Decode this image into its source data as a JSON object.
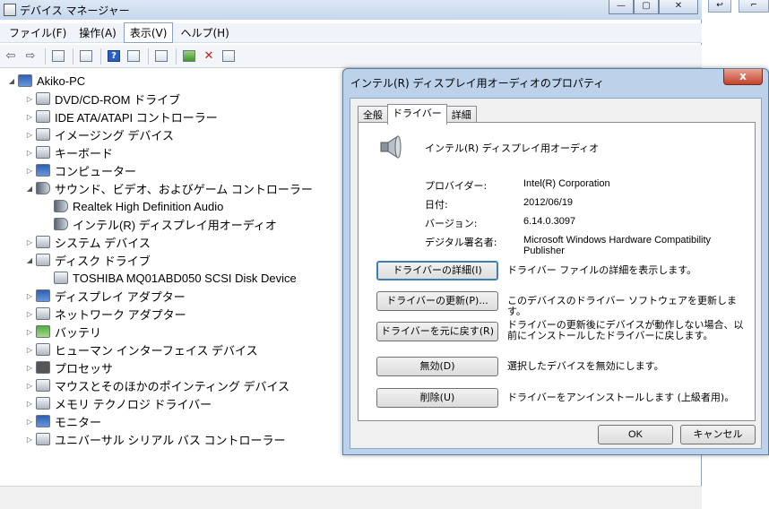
{
  "device_manager": {
    "title": "デバイス マネージャー",
    "menu": [
      "ファイル(F)",
      "操作(A)",
      "表示(V)",
      "ヘルプ(H)"
    ],
    "active_menu_index": 2,
    "toolbar_icons": [
      "back-icon",
      "forward-icon",
      "show-hide-tree-icon",
      "properties-icon",
      "help-icon",
      "action-icon",
      "scan-hardware-icon",
      "update-driver-icon",
      "uninstall-icon",
      "disable-icon"
    ],
    "tree": {
      "root": "Akiko-PC",
      "items": [
        {
          "label": "DVD/CD-ROM ドライブ",
          "icon": "dvd-drive-icon",
          "expanded": false
        },
        {
          "label": "IDE ATA/ATAPI コントローラー",
          "icon": "ide-controller-icon",
          "expanded": false
        },
        {
          "label": "イメージング デバイス",
          "icon": "imaging-device-icon",
          "expanded": false
        },
        {
          "label": "キーボード",
          "icon": "keyboard-icon",
          "expanded": false
        },
        {
          "label": "コンピューター",
          "icon": "computer-icon",
          "expanded": false
        },
        {
          "label": "サウンド、ビデオ、およびゲーム コントローラー",
          "icon": "speaker-icon",
          "expanded": true,
          "children": [
            "Realtek High Definition Audio",
            "インテル(R) ディスプレイ用オーディオ"
          ]
        },
        {
          "label": "システム デバイス",
          "icon": "system-device-icon",
          "expanded": false
        },
        {
          "label": "ディスク ドライブ",
          "icon": "disk-drive-icon",
          "expanded": true,
          "children": [
            "TOSHIBA MQ01ABD050 SCSI Disk Device"
          ]
        },
        {
          "label": "ディスプレイ アダプター",
          "icon": "display-adapter-icon",
          "expanded": false
        },
        {
          "label": "ネットワーク アダプター",
          "icon": "network-adapter-icon",
          "expanded": false
        },
        {
          "label": "バッテリ",
          "icon": "battery-icon",
          "expanded": false
        },
        {
          "label": "ヒューマン インターフェイス デバイス",
          "icon": "hid-icon",
          "expanded": false
        },
        {
          "label": "プロセッサ",
          "icon": "processor-icon",
          "expanded": false
        },
        {
          "label": "マウスとそのほかのポインティング デバイス",
          "icon": "mouse-icon",
          "expanded": false
        },
        {
          "label": "メモリ テクノロジ ドライバー",
          "icon": "memory-icon",
          "expanded": false
        },
        {
          "label": "モニター",
          "icon": "monitor-icon",
          "expanded": false
        },
        {
          "label": "ユニバーサル シリアル バス コントローラー",
          "icon": "usb-icon",
          "expanded": false
        }
      ]
    }
  },
  "dialog": {
    "title": "インテル(R) ディスプレイ用オーディオのプロパティ",
    "close_label": "x",
    "tabs": [
      "全般",
      "ドライバー",
      "詳細"
    ],
    "active_tab_index": 1,
    "device_name": "インテル(R) ディスプレイ用オーディオ",
    "properties": [
      {
        "label": "プロバイダー:",
        "value": "Intel(R) Corporation"
      },
      {
        "label": "日付:",
        "value": "2012/06/19"
      },
      {
        "label": "バージョン:",
        "value": "6.14.0.3097"
      },
      {
        "label": "デジタル署名者:",
        "value": "Microsoft Windows Hardware Compatibility Publisher"
      }
    ],
    "actions": [
      {
        "button": "ドライバーの詳細(I)",
        "description": "ドライバー ファイルの詳細を表示します。"
      },
      {
        "button": "ドライバーの更新(P)...",
        "description": "このデバイスのドライバー ソフトウェアを更新します。"
      },
      {
        "button": "ドライバーを元に戻す(R)",
        "description": "ドライバーの更新後にデバイスが動作しない場合、以前にインストールしたドライバーに戻します。"
      },
      {
        "button": "無効(D)",
        "description": "選択したデバイスを無効にします。"
      },
      {
        "button": "削除(U)",
        "description": "ドライバーをアンインストールします (上級者用)。"
      }
    ],
    "ok_label": "OK",
    "cancel_label": "キャンセル"
  }
}
